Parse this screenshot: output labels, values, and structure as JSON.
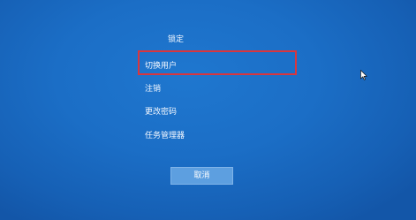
{
  "menu": {
    "items": [
      {
        "id": "lock",
        "label": "锁定"
      },
      {
        "id": "switch_user",
        "label": "切换用户"
      },
      {
        "id": "sign_out",
        "label": "注销"
      },
      {
        "id": "change_password",
        "label": "更改密码"
      },
      {
        "id": "task_manager",
        "label": "任务管理器"
      }
    ],
    "highlighted_item": "switch_user"
  },
  "actions": {
    "cancel_label": "取消"
  },
  "colors": {
    "background": "#1b6ec6",
    "text": "#f4f8ff",
    "highlight_border": "#d9363e",
    "button_bg": "#5d9fe0"
  },
  "icons": {
    "cursor": "mouse-pointer-icon"
  }
}
